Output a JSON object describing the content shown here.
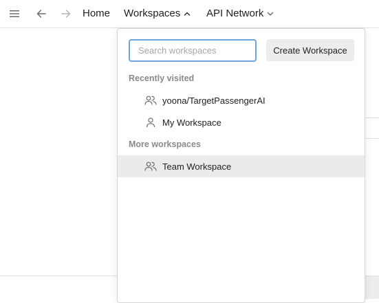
{
  "header": {
    "menu_icon": "hamburger-icon",
    "back_icon": "arrow-left-icon",
    "forward_icon": "arrow-right-icon",
    "home_label": "Home",
    "workspaces_label": "Workspaces",
    "api_network_label": "API Network"
  },
  "dropdown": {
    "search_placeholder": "Search workspaces",
    "create_label": "Create Workspace",
    "recent_title": "Recently visited",
    "recent_items": [
      {
        "label": "yoona/TargetPassengerAI",
        "icon": "team-icon"
      },
      {
        "label": "My Workspace",
        "icon": "person-icon"
      }
    ],
    "more_title": "More workspaces",
    "more_items": [
      {
        "label": "Team Workspace",
        "icon": "team-icon",
        "highlighted": true
      }
    ]
  },
  "colors": {
    "focus_border": "#6fa2d8",
    "hover_bg": "#ebebeb",
    "button_bg": "#ededed",
    "section_text": "#8a8a8a"
  }
}
